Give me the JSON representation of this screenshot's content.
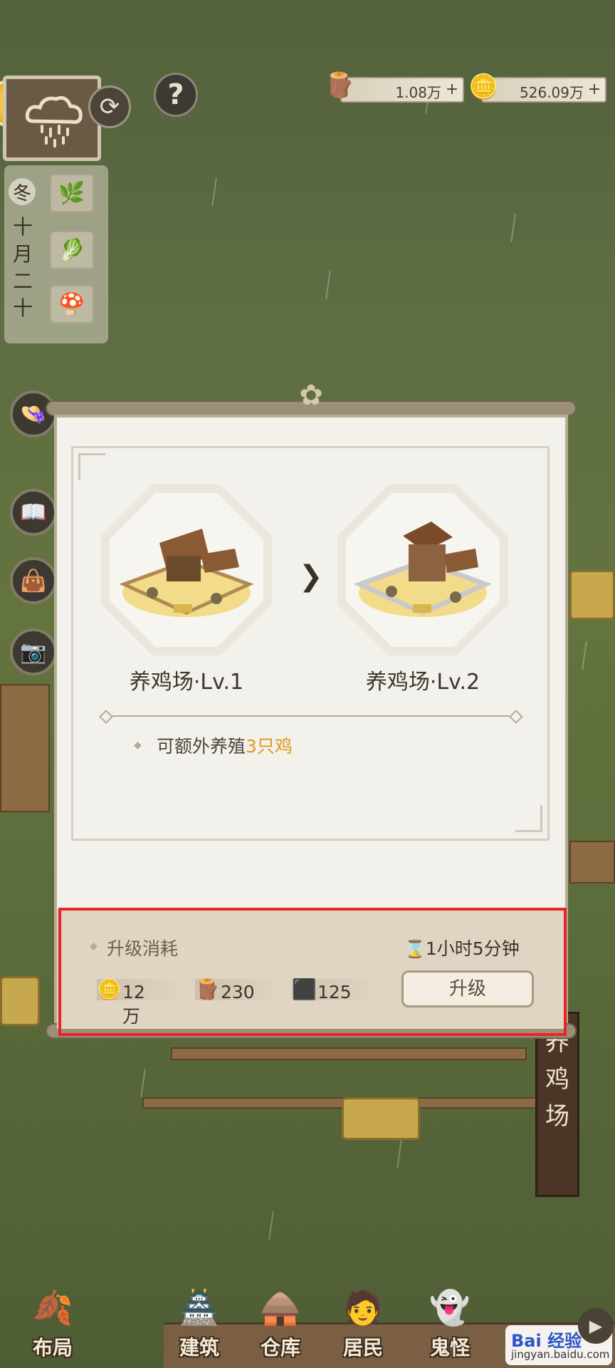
{
  "resources": {
    "wood": {
      "value": "1.08万",
      "icon": "wood-log-icon"
    },
    "coins": {
      "value": "526.09万",
      "icon": "copper-coin-icon"
    }
  },
  "calendar": {
    "season": "冬",
    "date_chars": [
      "十",
      "月",
      "二",
      "十"
    ]
  },
  "modal": {
    "current": {
      "name": "养鸡场·Lv.1"
    },
    "next": {
      "name": "养鸡场·Lv.2"
    },
    "benefit_prefix": "可额外养殖",
    "benefit_highlight": "3只鸡",
    "cost_title": "升级消耗",
    "duration": "1小时5分钟",
    "costs": [
      {
        "icon": "copper-coin-icon",
        "amount": "12万"
      },
      {
        "icon": "wood-log-icon",
        "amount": "230"
      },
      {
        "icon": "stone-block-icon",
        "amount": "125"
      }
    ],
    "upgrade_label": "升级"
  },
  "building_sign": [
    "养",
    "鸡",
    "场"
  ],
  "nav": [
    {
      "label": "布局",
      "icon": "layout-icon"
    },
    {
      "label": "建筑",
      "icon": "building-icon"
    },
    {
      "label": "仓库",
      "icon": "warehouse-icon"
    },
    {
      "label": "居民",
      "icon": "residents-icon"
    },
    {
      "label": "鬼怪",
      "icon": "ghost-icon"
    }
  ],
  "watermark": {
    "brand": "Bai 经验",
    "url": "jingyan.baidu.com"
  },
  "colors": {
    "highlight_border": "#e8242a",
    "accent_orange": "#e0981e"
  }
}
